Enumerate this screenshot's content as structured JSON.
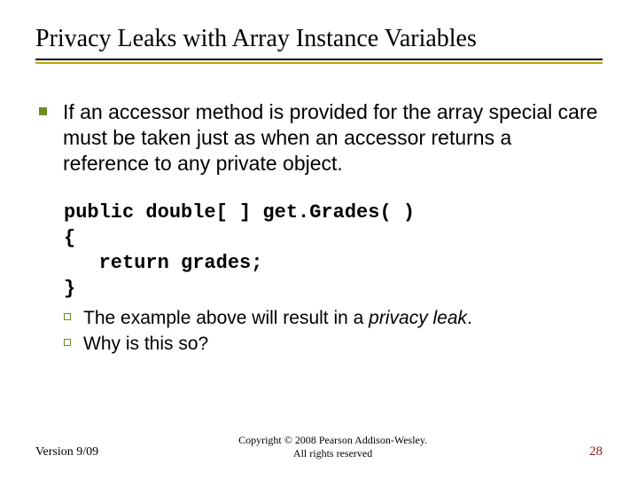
{
  "title": "Privacy Leaks with Array Instance Variables",
  "para1": "If an accessor method is provided for the array special care must be taken just as when an accessor returns a reference to any private object.",
  "code": "public double[ ] get.Grades( )\n{\n   return grades;\n}",
  "sub1_a": "The example above will result in a ",
  "sub1_b": "privacy leak",
  "sub1_c": ".",
  "sub2": "Why is this so?",
  "footer": {
    "version": "Version 9/09",
    "copyright_l1": "Copyright © 2008 Pearson Addison-Wesley.",
    "copyright_l2": "All rights reserved",
    "page": "28"
  }
}
